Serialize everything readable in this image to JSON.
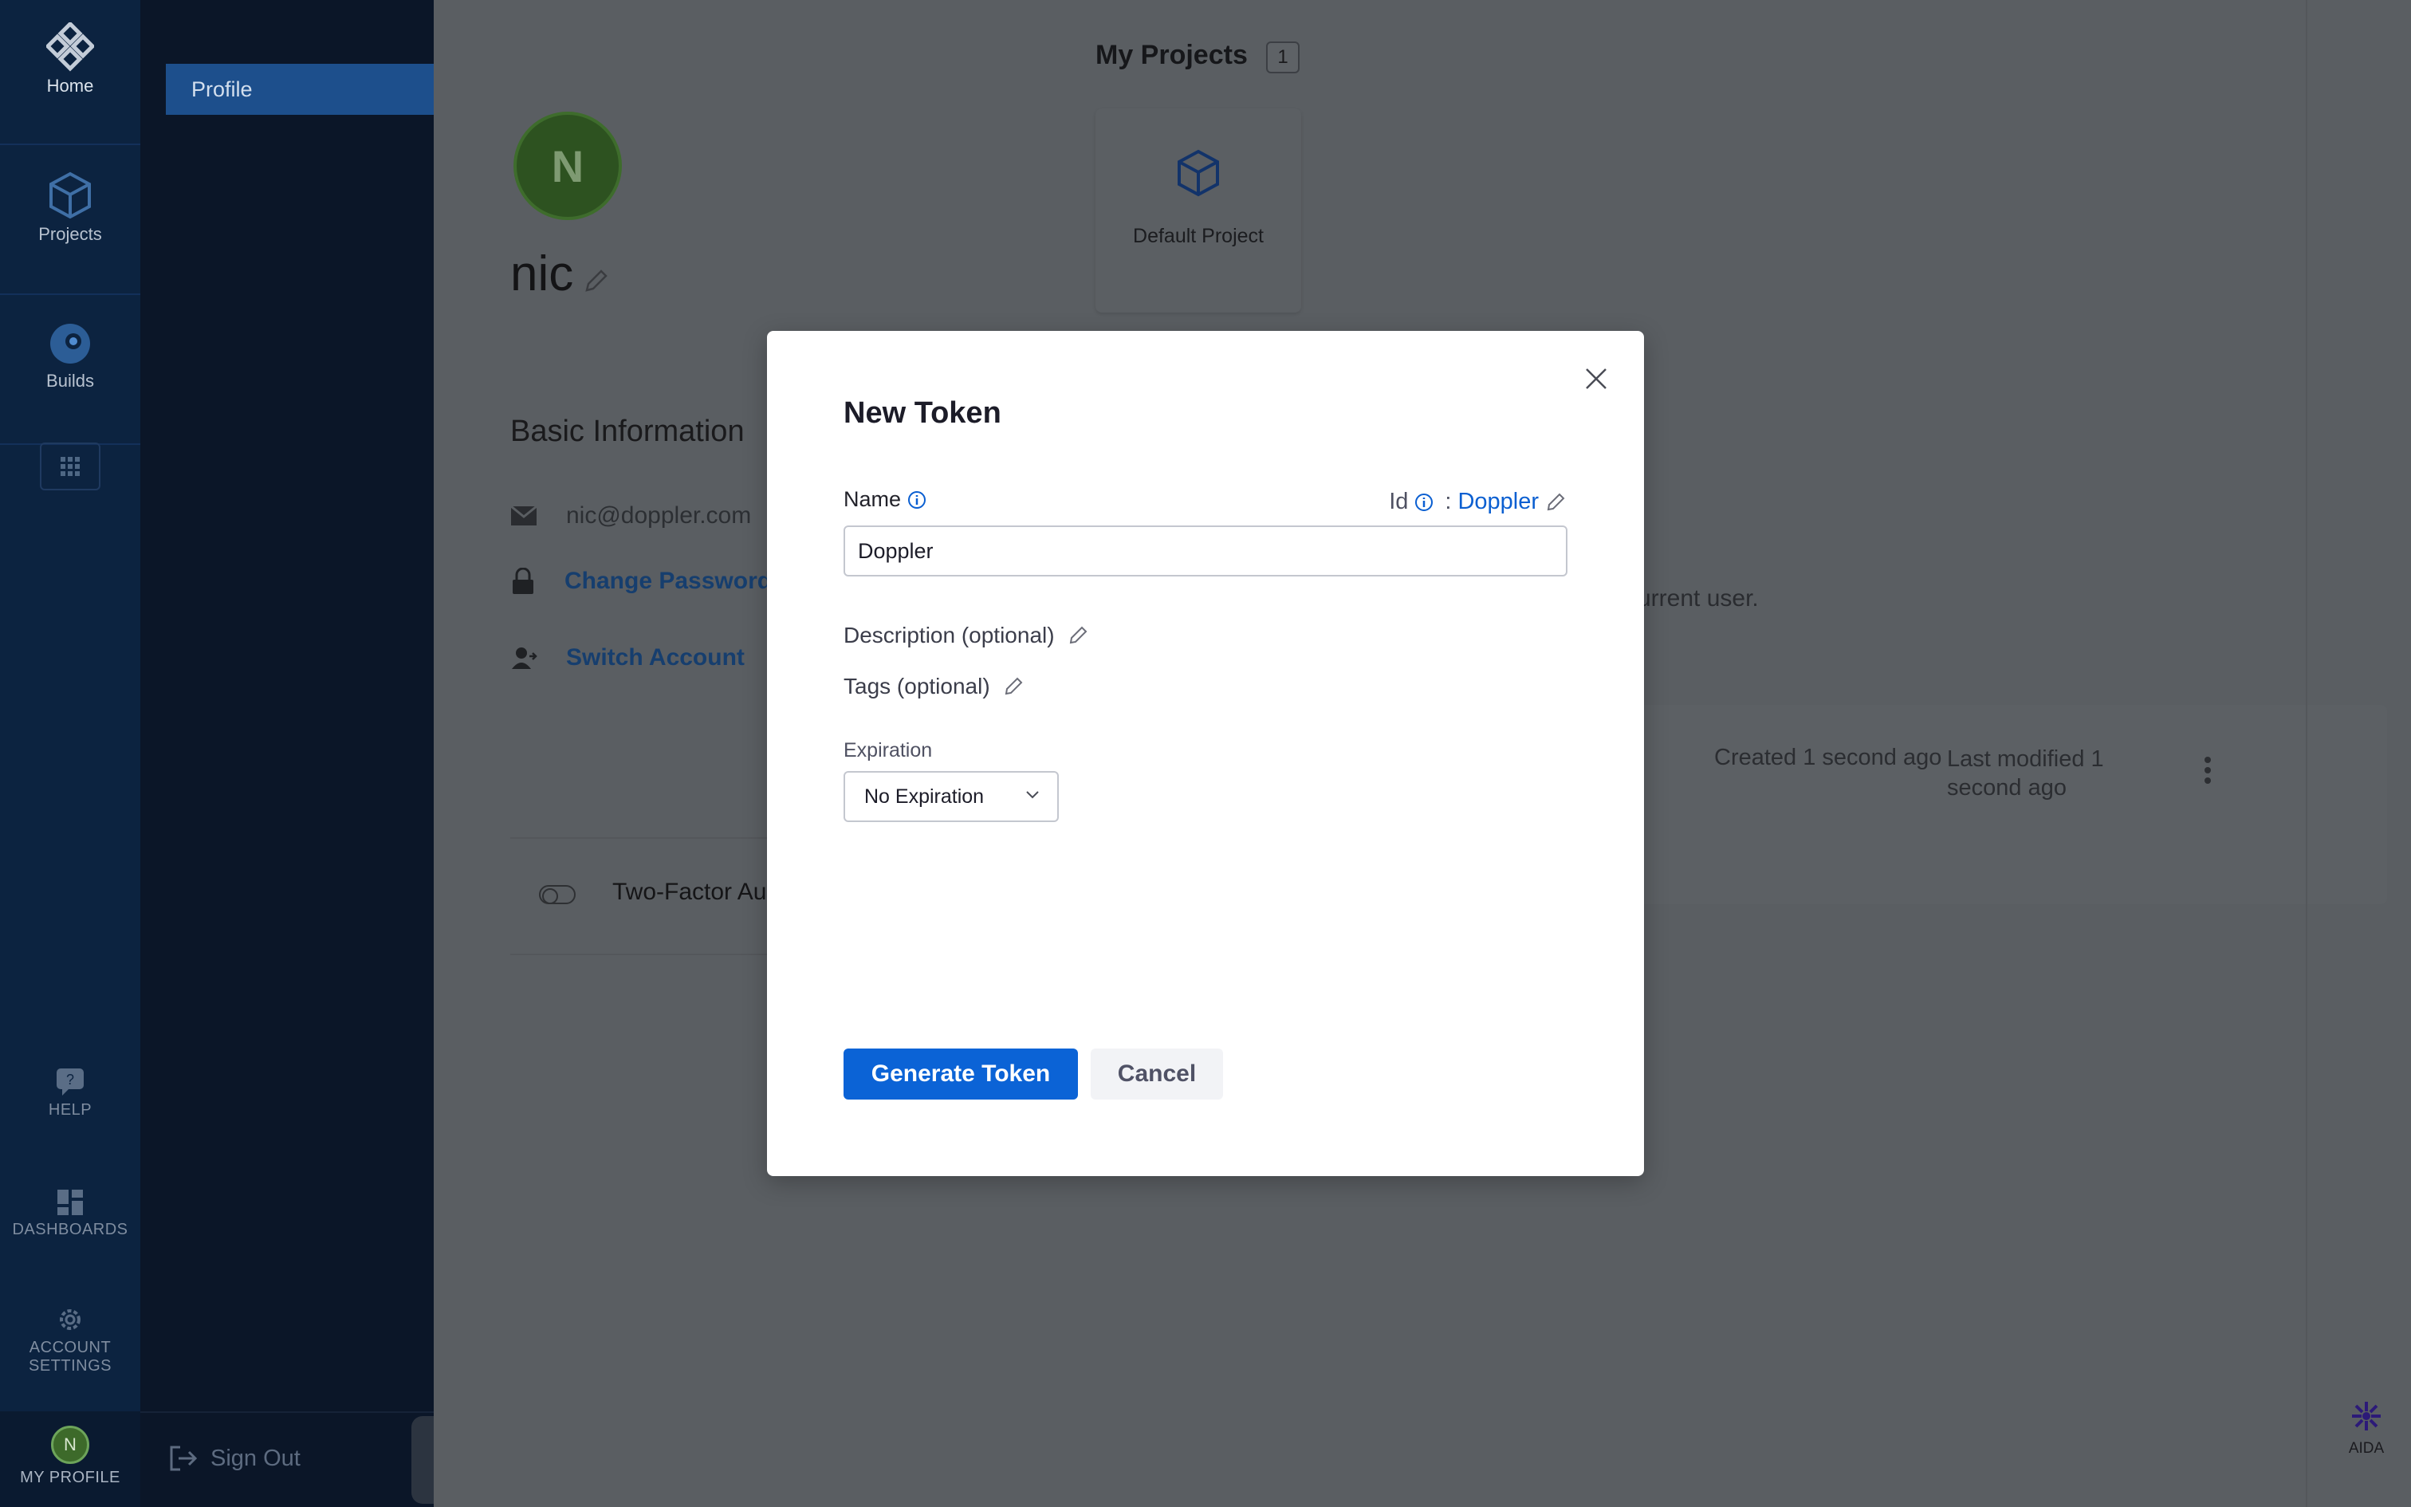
{
  "rail": {
    "home": "Home",
    "projects": "Projects",
    "builds": "Builds",
    "help": "HELP",
    "dashboards": "DASHBOARDS",
    "account_settings_1": "ACCOUNT",
    "account_settings_2": "SETTINGS",
    "profile_initial": "N",
    "my_profile": "MY PROFILE"
  },
  "sidebar": {
    "active_item": "Profile",
    "sign_out": "Sign Out"
  },
  "profile": {
    "initial": "N",
    "username": "nic",
    "basic_info_title": "Basic Information",
    "email": "nic@doppler.com",
    "change_password": "Change Password",
    "switch_account": "Switch Account",
    "two_factor": "Two-Factor Au"
  },
  "projects": {
    "title": "My Projects",
    "count": "1",
    "items": [
      {
        "name": "Default Project"
      }
    ]
  },
  "tokens": {
    "info_text": "urrent user.",
    "created": "Created 1 second ago",
    "last_modified": "Last modified 1 second ago"
  },
  "modal": {
    "title": "New Token",
    "name_label": "Name",
    "id_label": "Id",
    "id_separator": ":",
    "id_value": "Doppler",
    "name_value": "Doppler",
    "description_label": "Description (optional)",
    "tags_label": "Tags (optional)",
    "expiration_label": "Expiration",
    "expiration_value": "No Expiration",
    "generate_button": "Generate Token",
    "cancel_button": "Cancel"
  },
  "aida": {
    "label": "AIDA"
  },
  "colors": {
    "rail_bg": "#0c2340",
    "sidebar_bg": "#0b1628",
    "primary": "#0b63d6",
    "link": "#0b5fd1",
    "overlay": "#5a5e62"
  },
  "icons": [
    "harness-logo-icon",
    "projects-cube-icon",
    "builds-icon",
    "app-grid-icon",
    "help-icon",
    "dashboards-icon",
    "gear-icon",
    "sign-out-icon",
    "edit-pencil-icon",
    "mail-icon",
    "lock-icon",
    "switch-account-icon",
    "cube-icon",
    "kebab-menu-icon",
    "close-icon",
    "info-icon",
    "chevron-down-icon",
    "aida-icon"
  ]
}
